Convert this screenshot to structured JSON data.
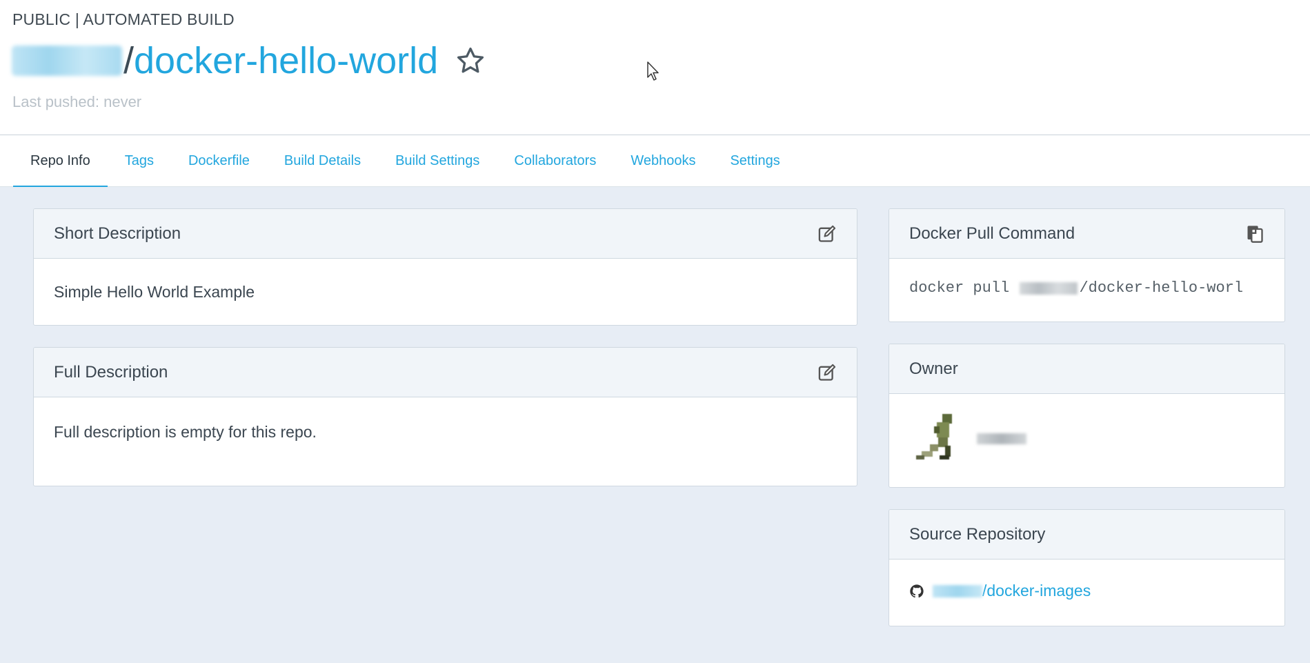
{
  "header": {
    "badge": "PUBLIC | AUTOMATED BUILD",
    "repo_separator": "/",
    "repo_name": "docker-hello-world",
    "last_pushed": "Last pushed: never"
  },
  "tabs": [
    {
      "label": "Repo Info",
      "active": true
    },
    {
      "label": "Tags"
    },
    {
      "label": "Dockerfile"
    },
    {
      "label": "Build Details"
    },
    {
      "label": "Build Settings"
    },
    {
      "label": "Collaborators"
    },
    {
      "label": "Webhooks"
    },
    {
      "label": "Settings"
    }
  ],
  "short_description": {
    "title": "Short Description",
    "text": "Simple Hello World Example"
  },
  "full_description": {
    "title": "Full Description",
    "text": "Full description is empty for this repo."
  },
  "pull_command": {
    "title": "Docker Pull Command",
    "prefix": "docker pull ",
    "suffix": "/docker-hello-worl"
  },
  "owner": {
    "title": "Owner"
  },
  "source_repository": {
    "title": "Source Repository",
    "repo": "/docker-images"
  },
  "colors": {
    "accent": "#22a6de",
    "page_bg": "#e7edf5",
    "panel_head_bg": "#f1f5f9"
  },
  "icons": {
    "star": "star-icon",
    "edit": "edit-icon",
    "copy": "copy-icon",
    "github": "github-icon",
    "cursor": "cursor-icon"
  }
}
